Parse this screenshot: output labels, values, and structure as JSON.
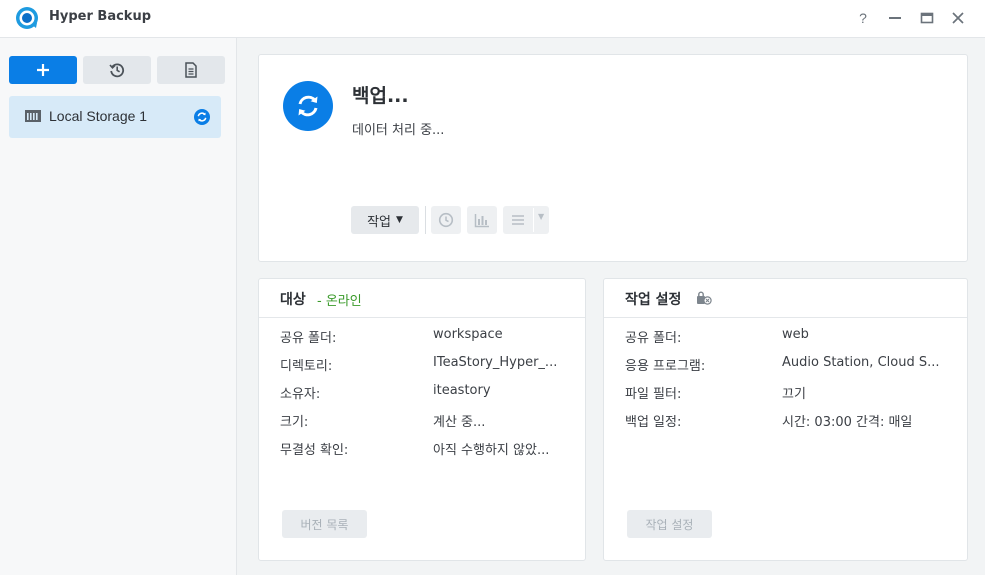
{
  "window": {
    "title": "Hyper Backup",
    "help_glyph": "?",
    "controls": [
      "help-icon",
      "minimize-icon",
      "maximize-icon",
      "close-icon"
    ]
  },
  "colors": {
    "accent": "#0a7ee6",
    "online": "#3a9a2a",
    "selected": "#d7eaf8"
  },
  "sidebar": {
    "buttons": [
      "plus-icon",
      "history-icon",
      "log-icon"
    ],
    "items": [
      {
        "label": "Local Storage 1",
        "icon": "storage-icon",
        "status_icon": "sync-icon"
      }
    ]
  },
  "status": {
    "title": "백업...",
    "subtitle": "데이터 처리 중...",
    "icon": "sync-icon",
    "toolbar": {
      "action_label": "작업",
      "disabled_icons": [
        "restore-clock-icon",
        "chart-icon",
        "menu-icon"
      ]
    }
  },
  "target": {
    "title": "대상",
    "status": "- 온라인",
    "rows": [
      {
        "label": "공유 폴더:",
        "value": "workspace"
      },
      {
        "label": "디렉토리:",
        "value": "ITeaStory_Hyper_..."
      },
      {
        "label": "소유자:",
        "value": "iteastory"
      },
      {
        "label": "크기:",
        "value": "계산 중..."
      },
      {
        "label": "무결성 확인:",
        "value": "아직 수행하지 않았..."
      }
    ],
    "button": "버전 목록"
  },
  "settings": {
    "title": "작업 설정",
    "icon": "lock-settings-icon",
    "rows": [
      {
        "label": "공유 폴더:",
        "value": "web"
      },
      {
        "label": "응용 프로그램:",
        "value": "Audio Station, Cloud S..."
      },
      {
        "label": "파일 필터:",
        "value": "끄기"
      },
      {
        "label": "백업 일정:",
        "value": "시간: 03:00 간격: 매일"
      }
    ],
    "button": "작업 설정"
  }
}
